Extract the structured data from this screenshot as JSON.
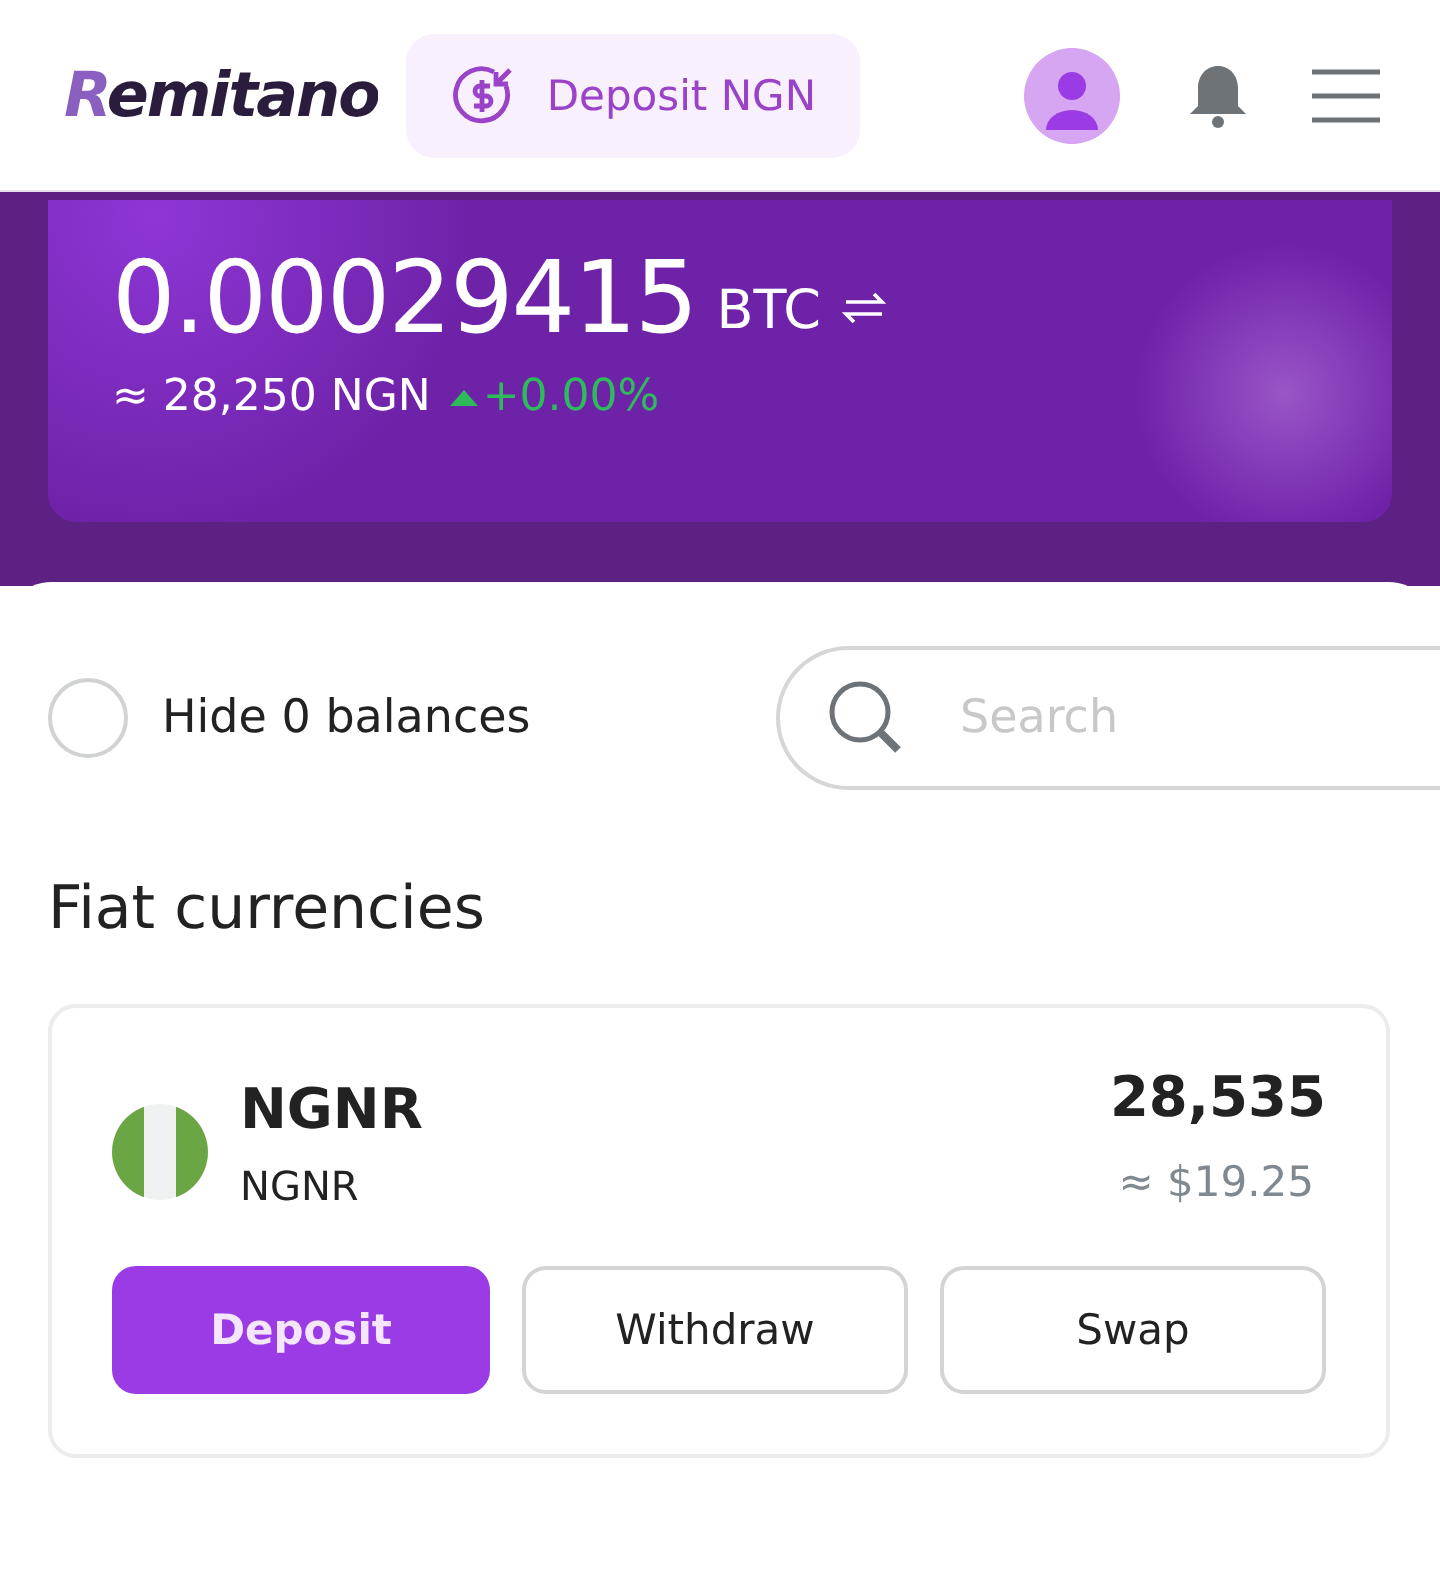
{
  "header": {
    "logo": "Remitano",
    "deposit_button": "Deposit NGN"
  },
  "balance": {
    "amount": "0.00029415",
    "unit": "BTC",
    "fiat": "≈ 28,250 NGN",
    "change": "+0.00%",
    "rising": true
  },
  "filters": {
    "hide_zero": {
      "label": "Hide 0 balances",
      "checked": false
    },
    "search": {
      "placeholder": "Search"
    }
  },
  "section_title": "Fiat currencies",
  "assets": [
    {
      "name": "NGNR",
      "code": "NGNR",
      "amount": "28,535",
      "usd": "≈ $19.25",
      "actions": [
        {
          "label": "Deposit",
          "kind": "primary"
        },
        {
          "label": "Withdraw",
          "kind": "outline"
        },
        {
          "label": "Swap",
          "kind": "outline"
        }
      ]
    }
  ]
}
